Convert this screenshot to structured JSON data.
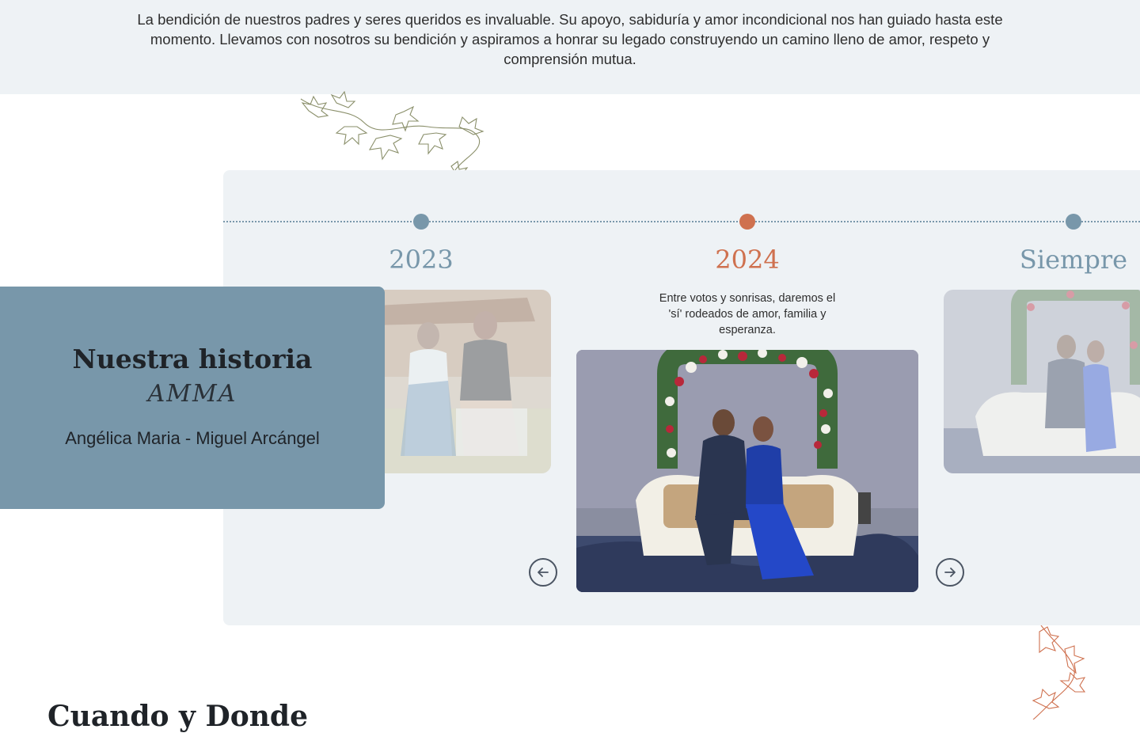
{
  "blessing": {
    "text": "La bendición de nuestros padres y seres queridos es invaluable. Su apoyo, sabiduría y amor incondicional nos han guiado hasta este momento. Llevamos con nosotros su bendición y aspiramos a honrar su legado construyendo un camino lleno de amor, respeto y comprensión mutua."
  },
  "timeline": {
    "items": [
      {
        "year": "2023",
        "state": "inactive",
        "color": "#7897aa"
      },
      {
        "year": "2024",
        "state": "active",
        "color": "#cf714f",
        "caption": "Entre votos y sonrisas, daremos el 'sí' rodeados de amor, familia y esperanza."
      },
      {
        "year": "Siempre",
        "state": "inactive",
        "color": "#7897aa"
      }
    ],
    "prev_icon": "arrow-left-circle-icon",
    "next_icon": "arrow-right-circle-icon"
  },
  "story": {
    "title": "Nuestra historia",
    "monogram": "AMMA",
    "names": "Angélica Maria - Miguel Arcángel"
  },
  "next_section": {
    "title": "Cuando y Donde"
  },
  "colors": {
    "panel_bg": "#eef2f5",
    "accent_blue": "#7897aa",
    "accent_orange": "#cf714f"
  }
}
